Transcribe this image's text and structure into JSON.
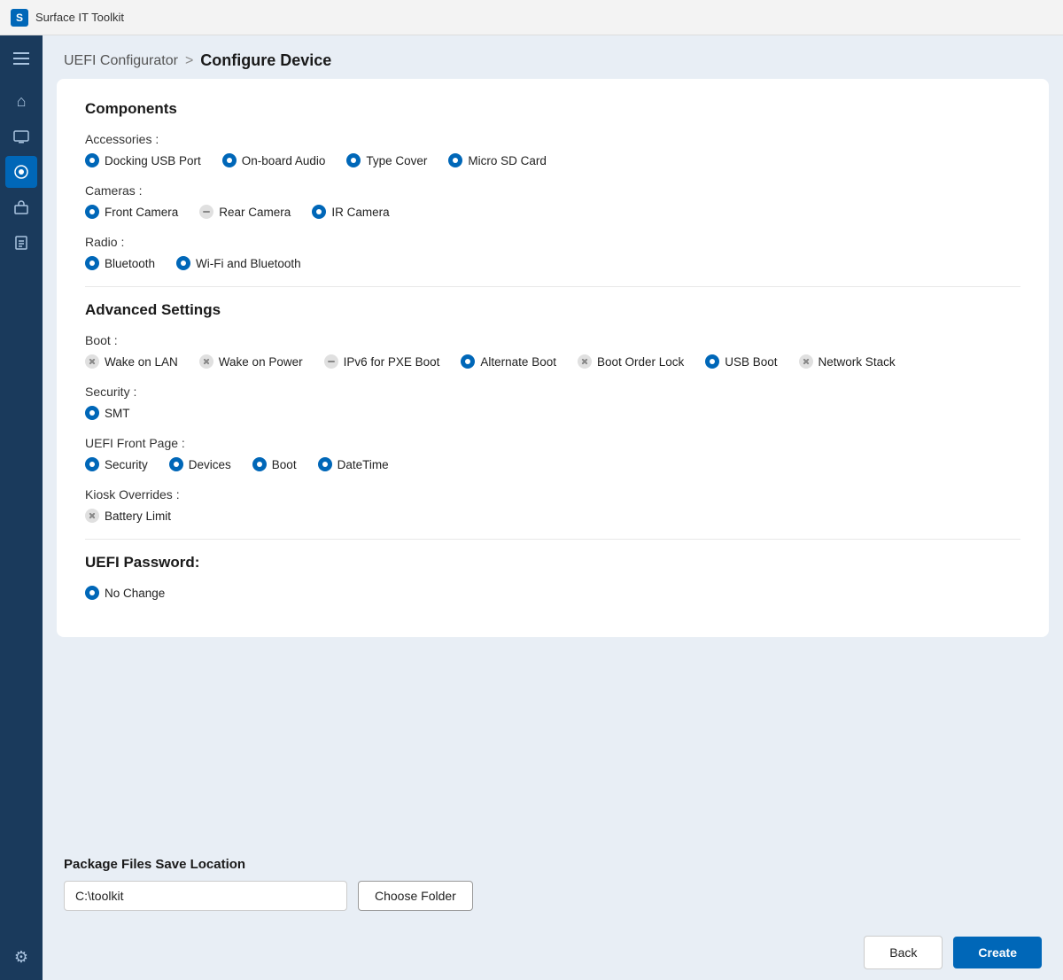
{
  "titleBar": {
    "appName": "Surface IT Toolkit",
    "iconText": "S"
  },
  "breadcrumb": {
    "parent": "UEFI Configurator",
    "separator": ">",
    "current": "Configure Device"
  },
  "sidebar": {
    "hamburgerLabel": "Menu",
    "items": [
      {
        "name": "home",
        "icon": "⌂",
        "active": false
      },
      {
        "name": "devices",
        "icon": "💻",
        "active": false
      },
      {
        "name": "uefi-configurator",
        "icon": "🔧",
        "active": true
      },
      {
        "name": "deployments",
        "icon": "📦",
        "active": false
      },
      {
        "name": "reports",
        "icon": "📊",
        "active": false
      }
    ],
    "settingsIcon": "⚙"
  },
  "components": {
    "sectionTitle": "Components",
    "accessories": {
      "label": "Accessories :",
      "items": [
        {
          "id": "docking-usb-port",
          "label": "Docking USB Port",
          "state": "filled"
        },
        {
          "id": "onboard-audio",
          "label": "On-board Audio",
          "state": "filled"
        },
        {
          "id": "type-cover",
          "label": "Type Cover",
          "state": "filled"
        },
        {
          "id": "micro-sd-card",
          "label": "Micro SD Card",
          "state": "filled"
        }
      ]
    },
    "cameras": {
      "label": "Cameras :",
      "items": [
        {
          "id": "front-camera",
          "label": "Front Camera",
          "state": "filled"
        },
        {
          "id": "rear-camera",
          "label": "Rear Camera",
          "state": "dash"
        },
        {
          "id": "ir-camera",
          "label": "IR Camera",
          "state": "filled"
        }
      ]
    },
    "radio": {
      "label": "Radio :",
      "items": [
        {
          "id": "bluetooth",
          "label": "Bluetooth",
          "state": "filled"
        },
        {
          "id": "wifi-bluetooth",
          "label": "Wi-Fi and Bluetooth",
          "state": "filled"
        }
      ]
    }
  },
  "advancedSettings": {
    "sectionTitle": "Advanced Settings",
    "boot": {
      "label": "Boot :",
      "items": [
        {
          "id": "wake-on-lan",
          "label": "Wake on LAN",
          "state": "x"
        },
        {
          "id": "wake-on-power",
          "label": "Wake on Power",
          "state": "x"
        },
        {
          "id": "ipv6-pxe",
          "label": "IPv6 for PXE Boot",
          "state": "dash"
        },
        {
          "id": "alternate-boot",
          "label": "Alternate Boot",
          "state": "filled"
        },
        {
          "id": "boot-order-lock",
          "label": "Boot Order Lock",
          "state": "x"
        },
        {
          "id": "usb-boot",
          "label": "USB Boot",
          "state": "filled"
        },
        {
          "id": "network-stack",
          "label": "Network Stack",
          "state": "x"
        }
      ]
    },
    "security": {
      "label": "Security :",
      "items": [
        {
          "id": "smt",
          "label": "SMT",
          "state": "filled"
        }
      ]
    },
    "uefiFrontPage": {
      "label": "UEFI Front Page :",
      "items": [
        {
          "id": "security",
          "label": "Security",
          "state": "filled"
        },
        {
          "id": "devices",
          "label": "Devices",
          "state": "filled"
        },
        {
          "id": "boot",
          "label": "Boot",
          "state": "filled"
        },
        {
          "id": "datetime",
          "label": "DateTime",
          "state": "filled"
        }
      ]
    },
    "kioskOverrides": {
      "label": "Kiosk Overrides :",
      "items": [
        {
          "id": "battery-limit",
          "label": "Battery Limit",
          "state": "x"
        }
      ]
    }
  },
  "uefiPassword": {
    "sectionTitle": "UEFI Password:",
    "items": [
      {
        "id": "no-change",
        "label": "No Change",
        "state": "filled"
      }
    ]
  },
  "packageFiles": {
    "label": "Package Files Save Location",
    "pathValue": "C:\\toolkit",
    "pathPlaceholder": "C:\\toolkit",
    "chooseFolderLabel": "Choose Folder"
  },
  "actions": {
    "backLabel": "Back",
    "createLabel": "Create"
  }
}
